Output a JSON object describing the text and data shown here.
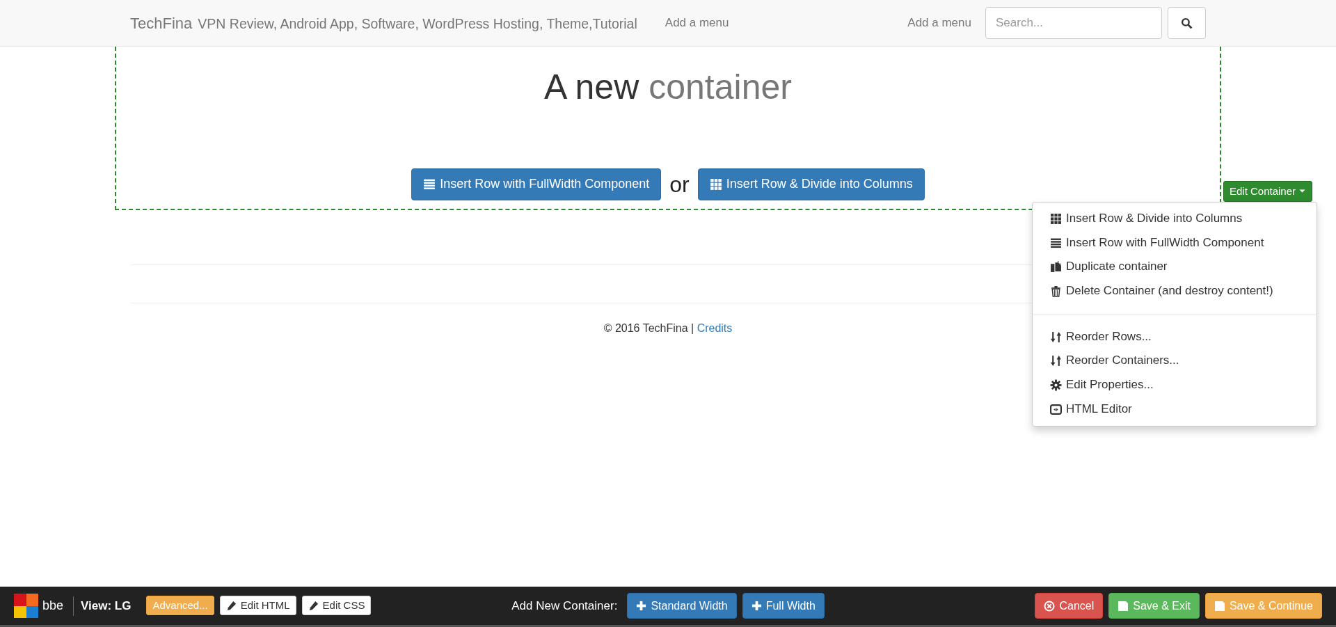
{
  "navbar": {
    "brand": "TechFina",
    "tagline": "VPN Review, Android App, Software, WordPress Hosting, Theme,Tutorial",
    "left_links": [
      "Add a menu"
    ],
    "right_links": [
      "Add a menu"
    ],
    "search": {
      "placeholder": "Search..."
    }
  },
  "container": {
    "heading": [
      {
        "text": "A new",
        "muted": false
      },
      {
        "text": "container",
        "muted": true
      }
    ],
    "actions": [
      {
        "label": "Insert Row with FullWidth Component",
        "kind": "fullwidth"
      },
      {
        "label": "Insert Row & Divide into Columns",
        "kind": "columns"
      }
    ],
    "separator": "or",
    "edit_button": {
      "label": "Edit Container",
      "expanded": true
    },
    "menu": [
      [
        {
          "label": "Insert Row & Divide into Columns",
          "kind": "columns"
        },
        {
          "label": "Insert Row with FullWidth Component",
          "kind": "fullwidth"
        },
        {
          "label": "Duplicate container",
          "kind": "duplicate"
        },
        {
          "label": "Delete Container (and destroy content!)",
          "kind": "delete"
        }
      ],
      [
        {
          "label": "Reorder Rows...",
          "kind": "reorder"
        },
        {
          "label": "Reorder Containers...",
          "kind": "reorder"
        },
        {
          "label": "Edit Properties...",
          "kind": "properties"
        },
        {
          "label": "HTML Editor",
          "kind": "editor"
        }
      ]
    ]
  },
  "footer": {
    "text": "© 2016 TechFina | ",
    "link": "Credits"
  },
  "bottom_bar": {
    "logo_text": "bbe",
    "view": "View: LG",
    "tools": [
      {
        "label": "Advanced...",
        "kind": "advanced"
      },
      {
        "label": "Edit HTML",
        "kind": "edit"
      },
      {
        "label": "Edit CSS",
        "kind": "edit"
      }
    ],
    "add_label": "Add New Container:",
    "add_buttons": [
      {
        "label": "Standard Width",
        "kind": "add"
      },
      {
        "label": "Full Width",
        "kind": "add"
      }
    ],
    "actions": [
      {
        "label": "Cancel",
        "kind": "cancel"
      },
      {
        "label": "Save & Exit",
        "kind": "save"
      },
      {
        "label": "Save & Continue",
        "kind": "save_continue"
      }
    ]
  }
}
